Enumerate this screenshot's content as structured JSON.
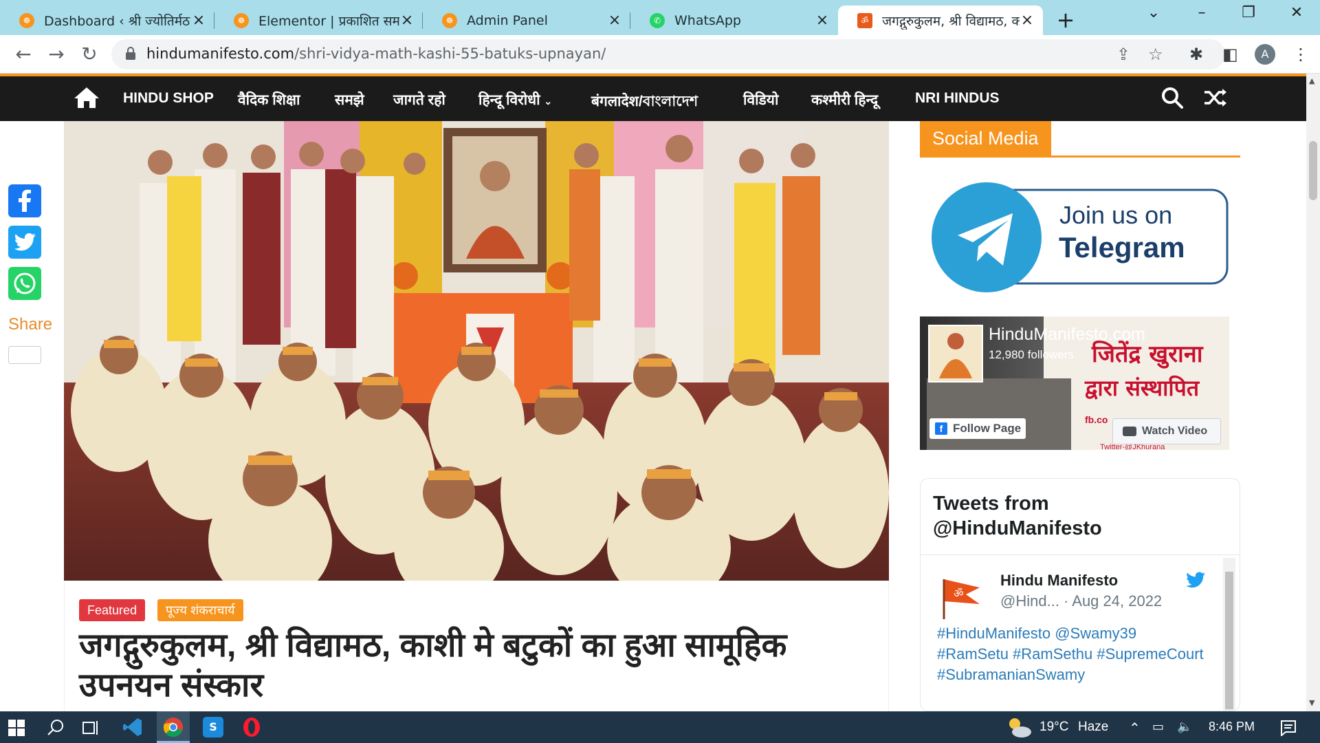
{
  "browser": {
    "tabs": [
      {
        "title": "Dashboard ‹ श्री ज्योतिर्मठ ब",
        "favicon": "orange-circle-icon",
        "close": "×"
      },
      {
        "title": "Elementor | प्रकाशित समाच",
        "favicon": "orange-circle-icon",
        "close": "×"
      },
      {
        "title": "Admin Panel",
        "favicon": "orange-circle-icon",
        "close": "×"
      },
      {
        "title": "WhatsApp",
        "favicon": "whatsapp-icon",
        "close": "×"
      },
      {
        "title": "जगद्गुरुकुलम, श्री विद्यामठ, क",
        "favicon": "hindumanifesto-icon",
        "close": "×"
      }
    ],
    "url_host": "hindumanifesto.com",
    "url_path": "/shri-vidya-math-kashi-55-batuks-upnayan/",
    "profile_initial": "A"
  },
  "site_nav": {
    "items": [
      "HINDU SHOP",
      "वैदिक शिक्षा",
      "समझे",
      "जागते रहो",
      "हिन्दू विरोधी",
      "बंगलादेश/বাংলাদেশ",
      "विडियो",
      "कश्मीरी हिन्दू",
      "NRI HINDUS"
    ]
  },
  "share": {
    "label": "Share",
    "networks": [
      "facebook",
      "twitter",
      "whatsapp"
    ],
    "colors": {
      "facebook": "#1877f2",
      "twitter": "#1da1f2",
      "whatsapp": "#25d366"
    }
  },
  "article": {
    "tags": [
      {
        "label": "Featured",
        "color": "#e0383e"
      },
      {
        "label": "पूज्य शंकराचार्य",
        "color": "#f7941d"
      }
    ],
    "headline": "जगद्गुरुकुलम, श्री विद्यामठ, काशी मे बटुकों का हुआ सामूहिक उपनयन संस्कार"
  },
  "sidebar": {
    "social_title": "Social Media",
    "telegram": {
      "line1": "Join us on",
      "line2": "Telegram"
    },
    "facebook": {
      "page_name": "HinduManifesto.com",
      "followers": "12,980 followers",
      "follow_label": "Follow Page",
      "watch_label": "Watch Video",
      "promo_line1": "जितेंद्र खुराना",
      "promo_line2": "द्वारा संस्थापित",
      "promo_small": "fb.co",
      "promo_bottom": "Twitter-@JKhurana"
    },
    "twitter": {
      "title": "Tweets from @HinduManifesto",
      "user_name": "Hindu Manifesto",
      "handle": "@Hind...",
      "date": "· Aug 24, 2022",
      "lines": [
        "#HinduManifesto @Swamy39",
        "#RamSetu #RamSethu #SupremeCourt",
        "#SubramanianSwamy"
      ]
    }
  },
  "taskbar": {
    "temperature": "19°C",
    "weather": "Haze",
    "time": "8:46 PM"
  },
  "colors": {
    "accent": "#f7941d",
    "nav_bg": "#1b1b1b",
    "tab_strip": "#a8dde9"
  }
}
